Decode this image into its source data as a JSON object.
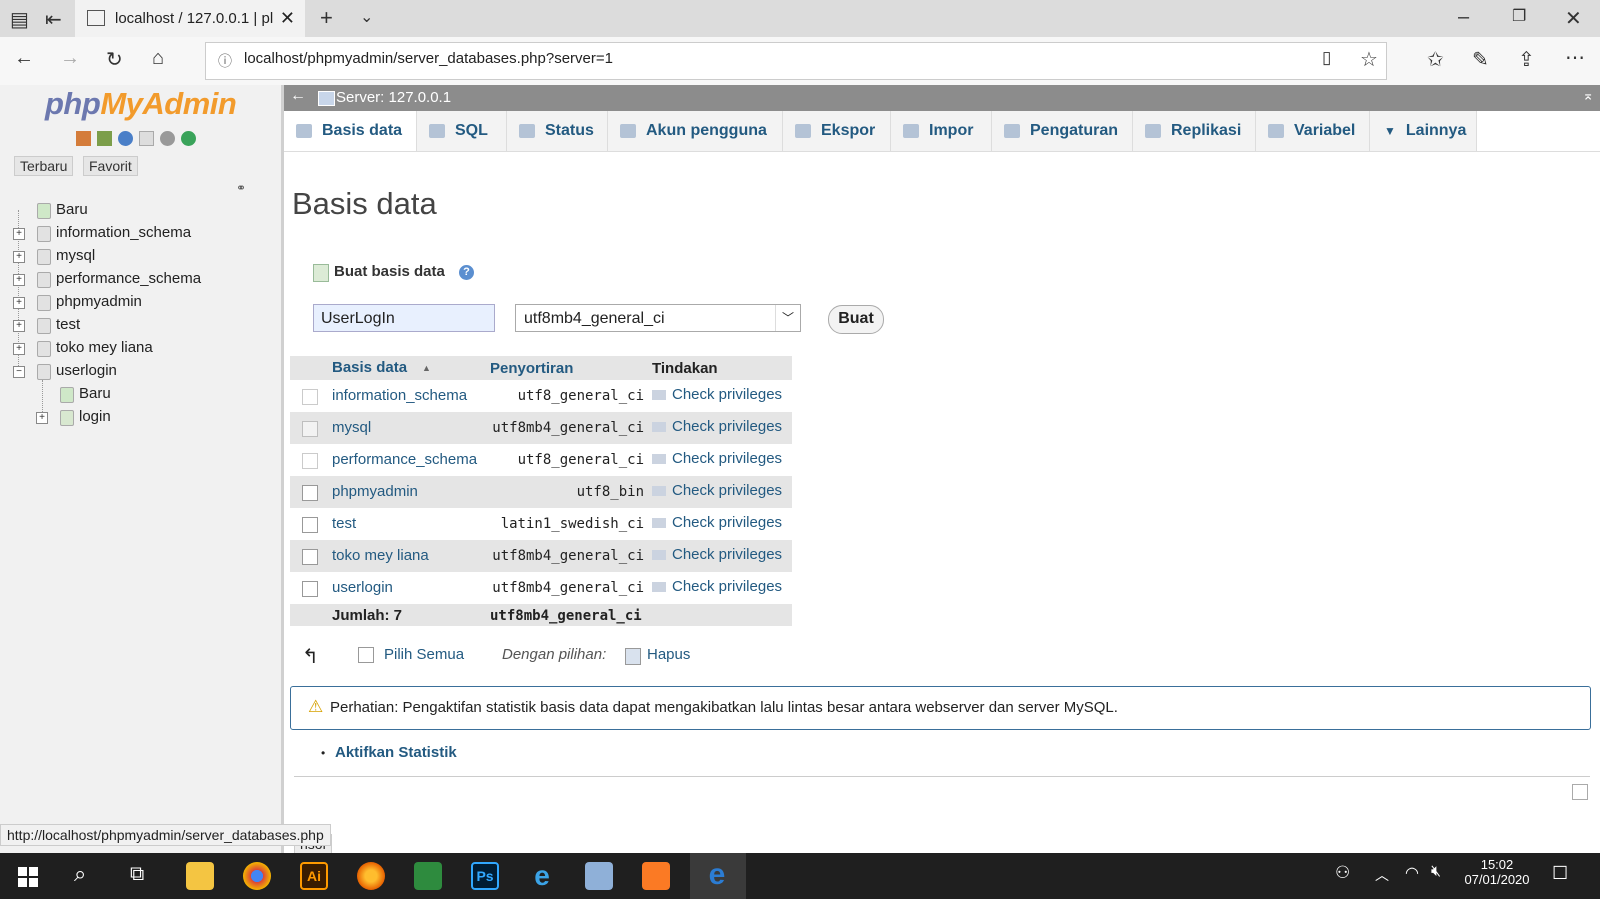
{
  "browser": {
    "tab_title": "localhost / 127.0.0.1 | pl",
    "url": "localhost/phpmyadmin/server_databases.php?server=1",
    "status_url": "http://localhost/phpmyadmin/server_databases.php"
  },
  "sidebar": {
    "logo_php": "php",
    "logo_myadmin": "MyAdmin",
    "recent_label": "Terbaru",
    "favorite_label": "Favorit",
    "tree": [
      {
        "label": "Baru"
      },
      {
        "label": "information_schema"
      },
      {
        "label": "mysql"
      },
      {
        "label": "performance_schema"
      },
      {
        "label": "phpmyadmin"
      },
      {
        "label": "test"
      },
      {
        "label": "toko mey liana"
      },
      {
        "label": "userlogin"
      },
      {
        "label": "Baru"
      },
      {
        "label": "login"
      }
    ],
    "console_label": "nsol"
  },
  "server_bar": {
    "label": "Server: 127.0.0.1"
  },
  "nav_tabs": [
    {
      "label": "Basis data"
    },
    {
      "label": "SQL"
    },
    {
      "label": "Status"
    },
    {
      "label": "Akun pengguna"
    },
    {
      "label": "Ekspor"
    },
    {
      "label": "Impor"
    },
    {
      "label": "Pengaturan"
    },
    {
      "label": "Replikasi"
    },
    {
      "label": "Variabel"
    },
    {
      "label": "Lainnya"
    }
  ],
  "page": {
    "title": "Basis data",
    "create_label": "Buat basis data",
    "db_name_value": "UserLogIn",
    "collation_value": "utf8mb4_general_ci",
    "create_button": "Buat"
  },
  "table": {
    "headers": {
      "name": "Basis data",
      "collation": "Penyortiran",
      "action": "Tindakan"
    },
    "rows": [
      {
        "name": "information_schema",
        "collation": "utf8_general_ci",
        "action": "Check privileges"
      },
      {
        "name": "mysql",
        "collation": "utf8mb4_general_ci",
        "action": "Check privileges"
      },
      {
        "name": "performance_schema",
        "collation": "utf8_general_ci",
        "action": "Check privileges"
      },
      {
        "name": "phpmyadmin",
        "collation": "utf8_bin",
        "action": "Check privileges"
      },
      {
        "name": "test",
        "collation": "latin1_swedish_ci",
        "action": "Check privileges"
      },
      {
        "name": "toko mey liana",
        "collation": "utf8mb4_general_ci",
        "action": "Check privileges"
      },
      {
        "name": "userlogin",
        "collation": "utf8mb4_general_ci",
        "action": "Check privileges"
      }
    ],
    "footer": {
      "total": "Jumlah: 7",
      "collation": "utf8mb4_general_ci"
    }
  },
  "bulk": {
    "select_all": "Pilih Semua",
    "with_selected": "Dengan pilihan:",
    "delete": "Hapus"
  },
  "notice": {
    "text": "Perhatian: Pengaktifan statistik basis data dapat mengakibatkan lalu lintas besar antara webserver dan server MySQL."
  },
  "enable_stats": "Aktifkan Statistik",
  "taskbar": {
    "time": "15:02",
    "date": "07/01/2020"
  }
}
